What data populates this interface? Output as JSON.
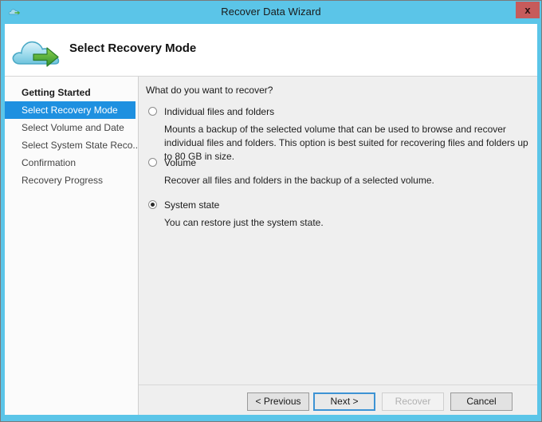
{
  "window": {
    "title": "Recover Data Wizard",
    "close_label": "x",
    "icon": "cloud-icon",
    "frame_color": "#5bc5e8",
    "titlebar_color": "#5bc5e8",
    "close_button_color": "#c75b5b"
  },
  "header": {
    "title": "Select Recovery Mode",
    "logo": "cloud-restore-icon"
  },
  "sidebar": {
    "items": [
      {
        "label": "Getting Started",
        "state": "completed"
      },
      {
        "label": "Select Recovery Mode",
        "state": "selected"
      },
      {
        "label": "Select Volume and Date",
        "state": "pending"
      },
      {
        "label": "Select System State Reco...",
        "state": "pending"
      },
      {
        "label": "Confirmation",
        "state": "pending"
      },
      {
        "label": "Recovery Progress",
        "state": "pending"
      }
    ],
    "selected_color": "#1e90e0"
  },
  "content": {
    "question": "What do you want to recover?",
    "options": [
      {
        "label": "Individual files and folders",
        "description": "Mounts a backup of the selected volume that can be used to browse and recover individual files and folders. This option is best suited for recovering files and folders up to 80 GB in size.",
        "checked": false
      },
      {
        "label": "Volume",
        "description": "Recover all files and folders in the backup of a selected volume.",
        "checked": false
      },
      {
        "label": "System state",
        "description": "You can restore just the system state.",
        "checked": true
      }
    ]
  },
  "footer": {
    "previous_label": "< Previous",
    "next_label": "Next >",
    "recover_label": "Recover",
    "cancel_label": "Cancel"
  }
}
